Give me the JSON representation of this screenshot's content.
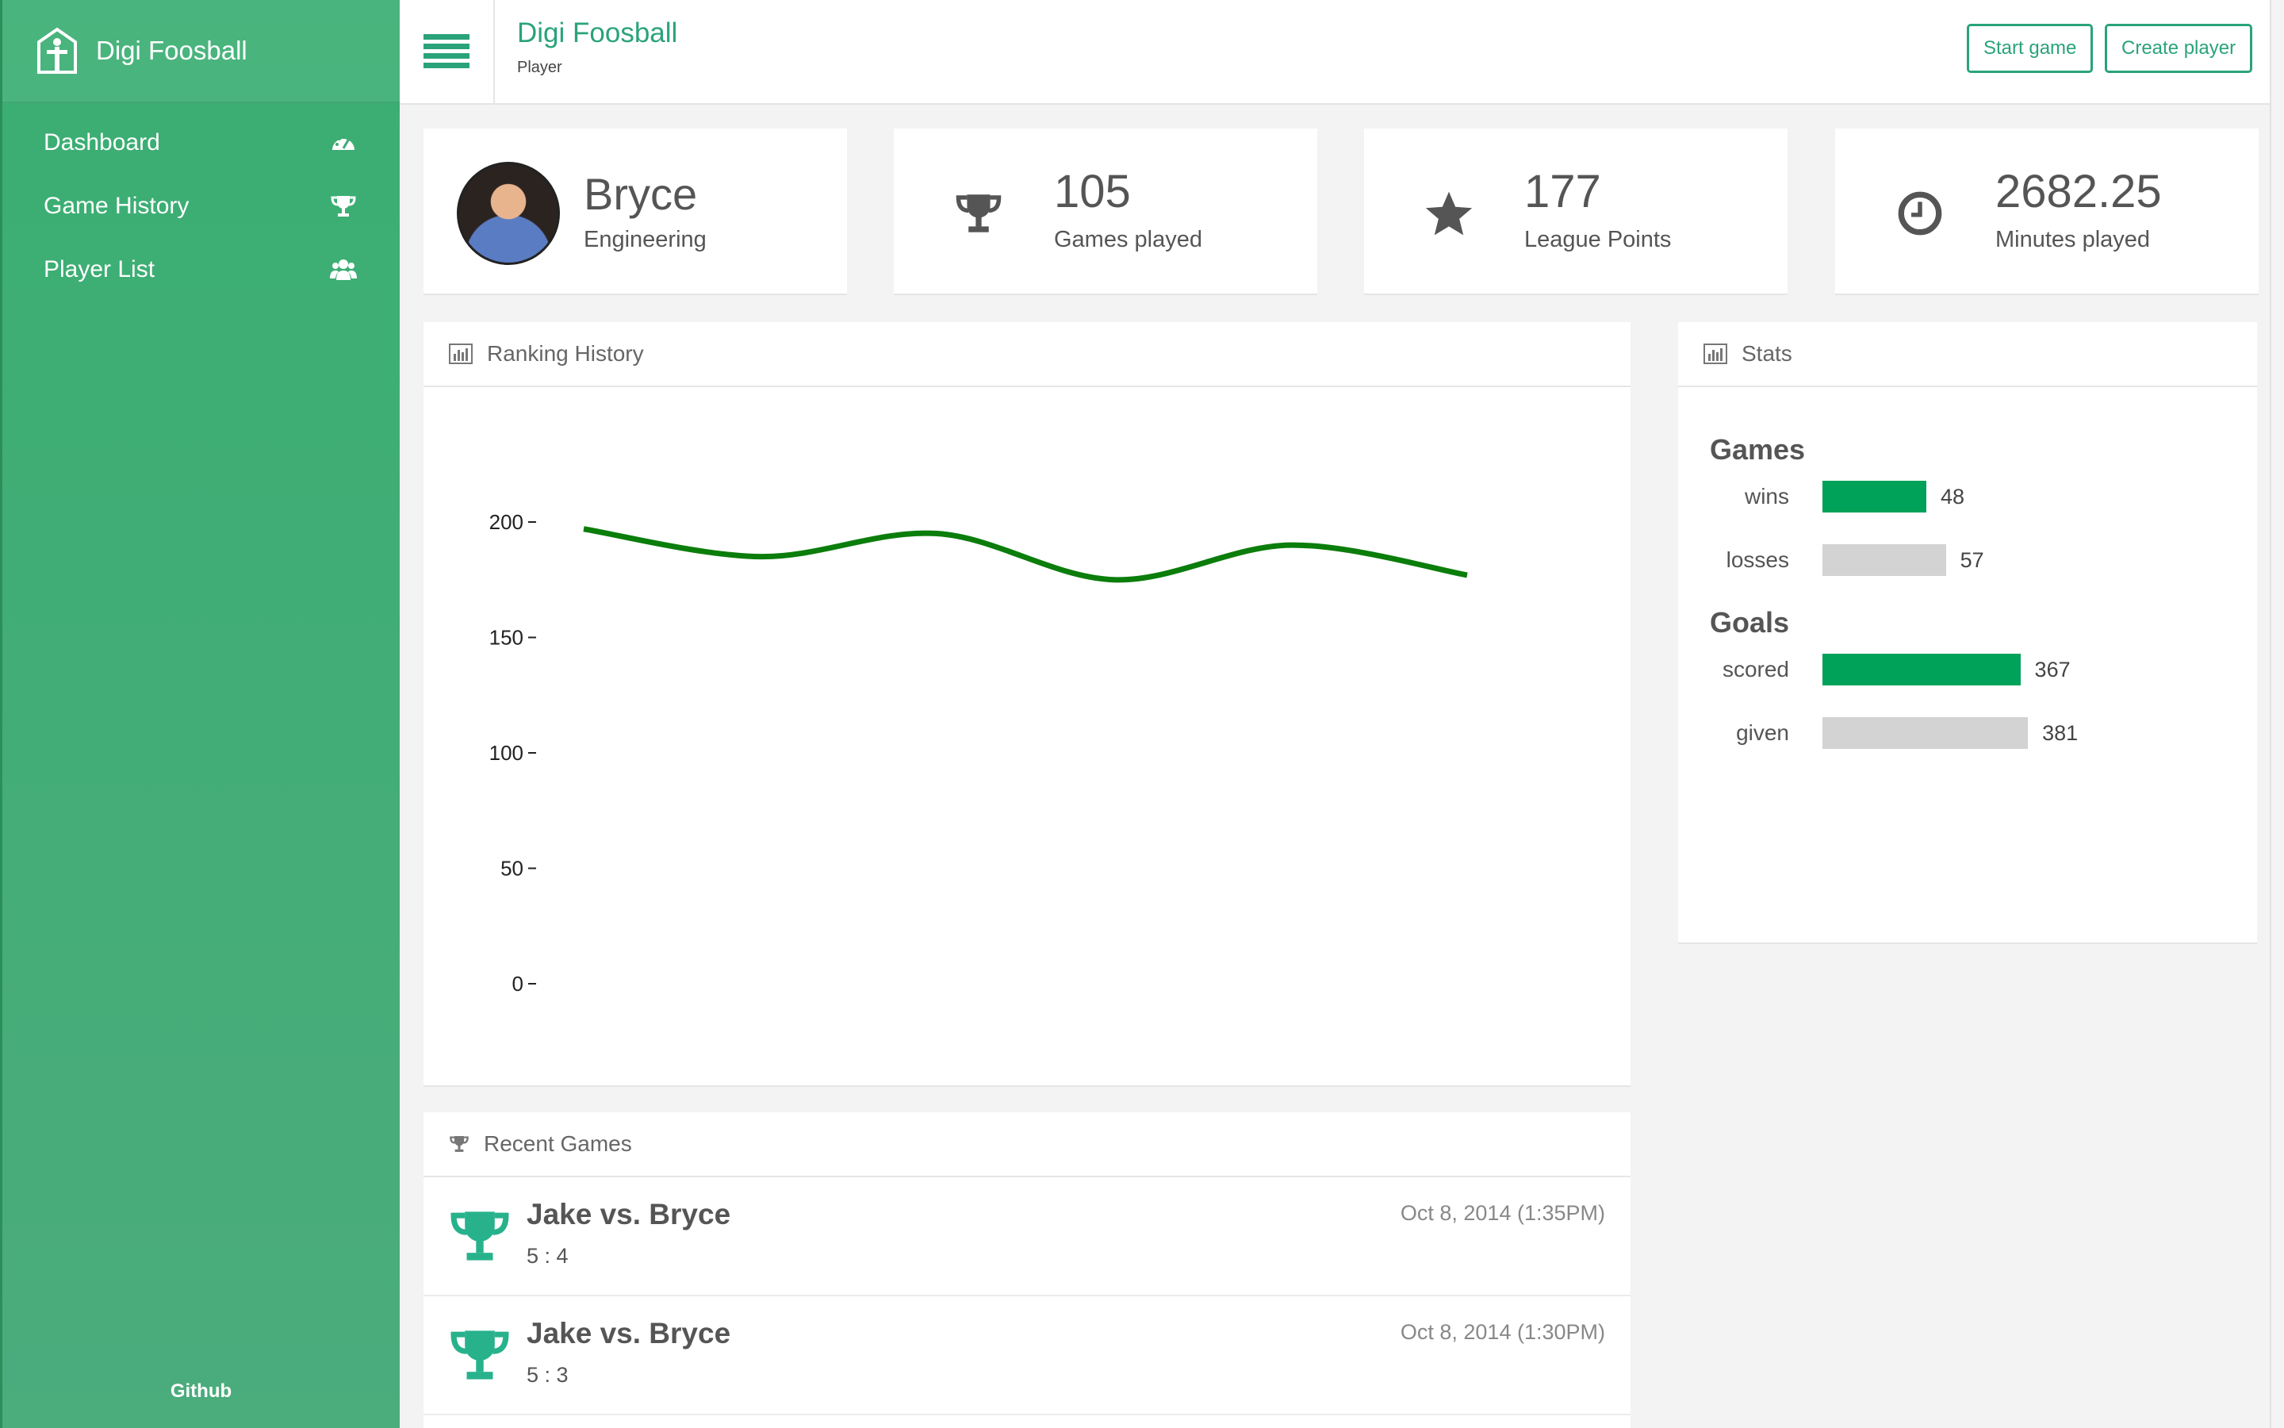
{
  "app": {
    "brand": "Digi Foosball",
    "github": "Github"
  },
  "sidebar": {
    "items": [
      {
        "label": "Dashboard",
        "icon": "dashboard-icon"
      },
      {
        "label": "Game History",
        "icon": "trophy-icon"
      },
      {
        "label": "Player List",
        "icon": "users-icon"
      }
    ]
  },
  "header": {
    "title": "Digi Foosball",
    "subtitle": "Player",
    "start_game": "Start game",
    "create_player": "Create player"
  },
  "player": {
    "name": "Bryce",
    "team": "Engineering"
  },
  "stats_cards": [
    {
      "value": "105",
      "label": "Games played",
      "icon": "trophy-icon"
    },
    {
      "value": "177",
      "label": "League Points",
      "icon": "star-icon"
    },
    {
      "value": "2682.25",
      "label": "Minutes played",
      "icon": "clock-icon"
    }
  ],
  "ranking": {
    "title": "Ranking History"
  },
  "chart_data": {
    "type": "line",
    "title": "",
    "xlabel": "",
    "ylabel": "",
    "ylim": [
      0,
      200
    ],
    "yticks": [
      0,
      50,
      100,
      150,
      200
    ],
    "series": [
      {
        "values": [
          197,
          185,
          195,
          175,
          190,
          177
        ]
      }
    ]
  },
  "stats": {
    "title": "Stats",
    "games_heading": "Games",
    "goals_heading": "Goals",
    "games": [
      {
        "label": "wins",
        "value": 48,
        "color": "#00a25a"
      },
      {
        "label": "losses",
        "value": 57,
        "color": "#d3d3d3"
      }
    ],
    "goals": [
      {
        "label": "scored",
        "value": 367,
        "color": "#00a25a"
      },
      {
        "label": "given",
        "value": 381,
        "color": "#d3d3d3"
      }
    ]
  },
  "recent": {
    "title": "Recent Games",
    "games": [
      {
        "title": "Jake vs. Bryce",
        "score": "5 : 4",
        "date": "Oct 8, 2014 (1:35PM)"
      },
      {
        "title": "Jake vs. Bryce",
        "score": "5 : 3",
        "date": "Oct 8, 2014 (1:30PM)"
      }
    ]
  },
  "colors": {
    "accent": "#2aa37a",
    "line": "#0b7d0b",
    "sidebar": "#3fab74"
  }
}
